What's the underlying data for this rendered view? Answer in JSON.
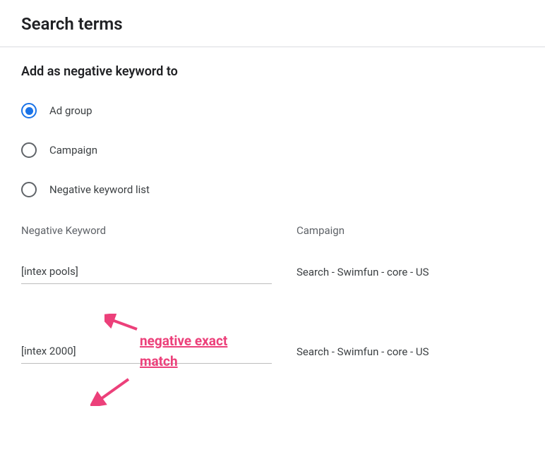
{
  "header": {
    "title": "Search terms"
  },
  "section": {
    "title": "Add as negative keyword to"
  },
  "radios": {
    "adgroup": {
      "label": "Ad group",
      "selected": true
    },
    "campaign": {
      "label": "Campaign",
      "selected": false
    },
    "list": {
      "label": "Negative keyword list",
      "selected": false
    }
  },
  "table": {
    "headers": {
      "keyword": "Negative Keyword",
      "campaign": "Campaign"
    },
    "rows": [
      {
        "keyword": "[intex pools]",
        "campaign": "Search - Swimfun - core - US"
      },
      {
        "keyword": "[intex 2000]",
        "campaign": "Search - Swimfun - core - US"
      }
    ]
  },
  "annotation": {
    "text": "negative exact match"
  }
}
